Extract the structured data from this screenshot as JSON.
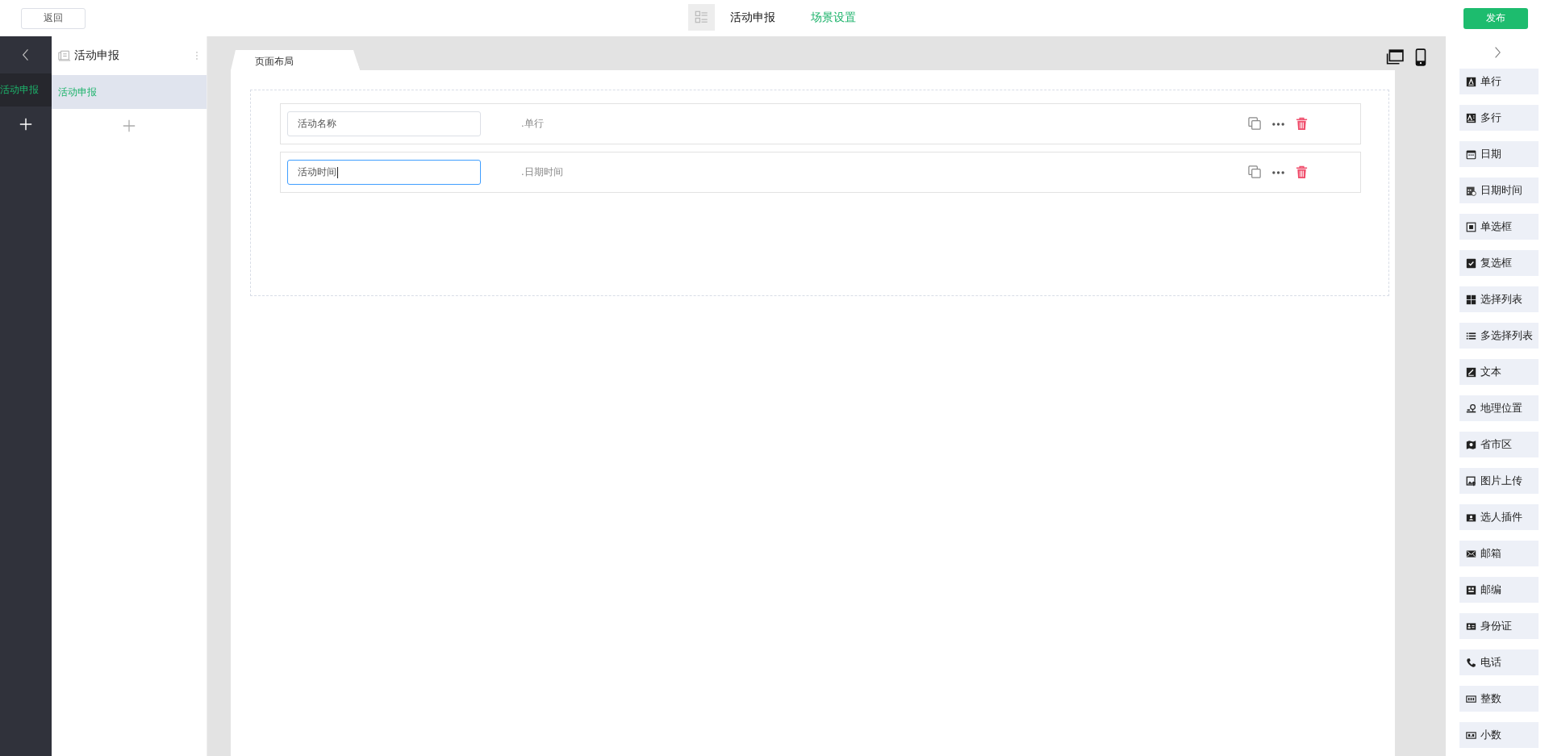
{
  "top_bar": {
    "back_button": "返回",
    "title": "活动申报",
    "scene_link": "场景设置",
    "publish_button": "发布"
  },
  "rail": {
    "items": [
      {
        "label": "活动申报",
        "selected": true
      }
    ]
  },
  "page_panel": {
    "title": "活动申报",
    "items": [
      {
        "label": "活动申报",
        "selected": true
      }
    ]
  },
  "canvas": {
    "tab": "页面布局",
    "fields": [
      {
        "value": "活动名称",
        "type_label": ".单行",
        "focused": false
      },
      {
        "value": "活动时间",
        "type_label": ".日期时间",
        "focused": true
      }
    ]
  },
  "palette": [
    {
      "kind": "text",
      "label": "单行"
    },
    {
      "kind": "textarea",
      "label": "多行"
    },
    {
      "kind": "date",
      "label": "日期"
    },
    {
      "kind": "datetime",
      "label": "日期时间"
    },
    {
      "kind": "radio",
      "label": "单选框"
    },
    {
      "kind": "checkbox",
      "label": "复选框"
    },
    {
      "kind": "grid",
      "label": "选择列表"
    },
    {
      "kind": "list",
      "label": "多选择列表"
    },
    {
      "kind": "edit",
      "label": "文本"
    },
    {
      "kind": "location",
      "label": "地理位置"
    },
    {
      "kind": "map",
      "label": "省市区"
    },
    {
      "kind": "image",
      "label": "图片上传"
    },
    {
      "kind": "person",
      "label": "选人插件"
    },
    {
      "kind": "mail",
      "label": "邮箱"
    },
    {
      "kind": "postcode",
      "label": "邮编"
    },
    {
      "kind": "idcard",
      "label": "身份证"
    },
    {
      "kind": "phone",
      "label": "电话"
    },
    {
      "kind": "integer",
      "label": "整数"
    },
    {
      "kind": "decimal",
      "label": "小数"
    }
  ]
}
